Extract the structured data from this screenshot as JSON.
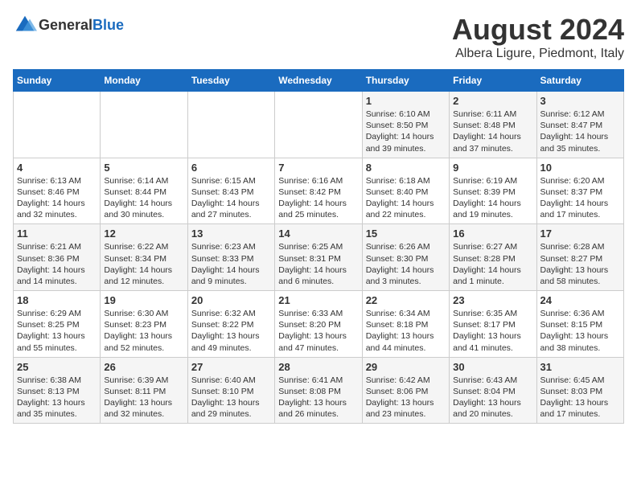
{
  "header": {
    "logo_general": "General",
    "logo_blue": "Blue",
    "title": "August 2024",
    "subtitle": "Albera Ligure, Piedmont, Italy"
  },
  "calendar": {
    "days_of_week": [
      "Sunday",
      "Monday",
      "Tuesday",
      "Wednesday",
      "Thursday",
      "Friday",
      "Saturday"
    ],
    "weeks": [
      [
        {
          "day": "",
          "info": ""
        },
        {
          "day": "",
          "info": ""
        },
        {
          "day": "",
          "info": ""
        },
        {
          "day": "",
          "info": ""
        },
        {
          "day": "1",
          "info": "Sunrise: 6:10 AM\nSunset: 8:50 PM\nDaylight: 14 hours and 39 minutes."
        },
        {
          "day": "2",
          "info": "Sunrise: 6:11 AM\nSunset: 8:48 PM\nDaylight: 14 hours and 37 minutes."
        },
        {
          "day": "3",
          "info": "Sunrise: 6:12 AM\nSunset: 8:47 PM\nDaylight: 14 hours and 35 minutes."
        }
      ],
      [
        {
          "day": "4",
          "info": "Sunrise: 6:13 AM\nSunset: 8:46 PM\nDaylight: 14 hours and 32 minutes."
        },
        {
          "day": "5",
          "info": "Sunrise: 6:14 AM\nSunset: 8:44 PM\nDaylight: 14 hours and 30 minutes."
        },
        {
          "day": "6",
          "info": "Sunrise: 6:15 AM\nSunset: 8:43 PM\nDaylight: 14 hours and 27 minutes."
        },
        {
          "day": "7",
          "info": "Sunrise: 6:16 AM\nSunset: 8:42 PM\nDaylight: 14 hours and 25 minutes."
        },
        {
          "day": "8",
          "info": "Sunrise: 6:18 AM\nSunset: 8:40 PM\nDaylight: 14 hours and 22 minutes."
        },
        {
          "day": "9",
          "info": "Sunrise: 6:19 AM\nSunset: 8:39 PM\nDaylight: 14 hours and 19 minutes."
        },
        {
          "day": "10",
          "info": "Sunrise: 6:20 AM\nSunset: 8:37 PM\nDaylight: 14 hours and 17 minutes."
        }
      ],
      [
        {
          "day": "11",
          "info": "Sunrise: 6:21 AM\nSunset: 8:36 PM\nDaylight: 14 hours and 14 minutes."
        },
        {
          "day": "12",
          "info": "Sunrise: 6:22 AM\nSunset: 8:34 PM\nDaylight: 14 hours and 12 minutes."
        },
        {
          "day": "13",
          "info": "Sunrise: 6:23 AM\nSunset: 8:33 PM\nDaylight: 14 hours and 9 minutes."
        },
        {
          "day": "14",
          "info": "Sunrise: 6:25 AM\nSunset: 8:31 PM\nDaylight: 14 hours and 6 minutes."
        },
        {
          "day": "15",
          "info": "Sunrise: 6:26 AM\nSunset: 8:30 PM\nDaylight: 14 hours and 3 minutes."
        },
        {
          "day": "16",
          "info": "Sunrise: 6:27 AM\nSunset: 8:28 PM\nDaylight: 14 hours and 1 minute."
        },
        {
          "day": "17",
          "info": "Sunrise: 6:28 AM\nSunset: 8:27 PM\nDaylight: 13 hours and 58 minutes."
        }
      ],
      [
        {
          "day": "18",
          "info": "Sunrise: 6:29 AM\nSunset: 8:25 PM\nDaylight: 13 hours and 55 minutes."
        },
        {
          "day": "19",
          "info": "Sunrise: 6:30 AM\nSunset: 8:23 PM\nDaylight: 13 hours and 52 minutes."
        },
        {
          "day": "20",
          "info": "Sunrise: 6:32 AM\nSunset: 8:22 PM\nDaylight: 13 hours and 49 minutes."
        },
        {
          "day": "21",
          "info": "Sunrise: 6:33 AM\nSunset: 8:20 PM\nDaylight: 13 hours and 47 minutes."
        },
        {
          "day": "22",
          "info": "Sunrise: 6:34 AM\nSunset: 8:18 PM\nDaylight: 13 hours and 44 minutes."
        },
        {
          "day": "23",
          "info": "Sunrise: 6:35 AM\nSunset: 8:17 PM\nDaylight: 13 hours and 41 minutes."
        },
        {
          "day": "24",
          "info": "Sunrise: 6:36 AM\nSunset: 8:15 PM\nDaylight: 13 hours and 38 minutes."
        }
      ],
      [
        {
          "day": "25",
          "info": "Sunrise: 6:38 AM\nSunset: 8:13 PM\nDaylight: 13 hours and 35 minutes."
        },
        {
          "day": "26",
          "info": "Sunrise: 6:39 AM\nSunset: 8:11 PM\nDaylight: 13 hours and 32 minutes."
        },
        {
          "day": "27",
          "info": "Sunrise: 6:40 AM\nSunset: 8:10 PM\nDaylight: 13 hours and 29 minutes."
        },
        {
          "day": "28",
          "info": "Sunrise: 6:41 AM\nSunset: 8:08 PM\nDaylight: 13 hours and 26 minutes."
        },
        {
          "day": "29",
          "info": "Sunrise: 6:42 AM\nSunset: 8:06 PM\nDaylight: 13 hours and 23 minutes."
        },
        {
          "day": "30",
          "info": "Sunrise: 6:43 AM\nSunset: 8:04 PM\nDaylight: 13 hours and 20 minutes."
        },
        {
          "day": "31",
          "info": "Sunrise: 6:45 AM\nSunset: 8:03 PM\nDaylight: 13 hours and 17 minutes."
        }
      ]
    ]
  }
}
